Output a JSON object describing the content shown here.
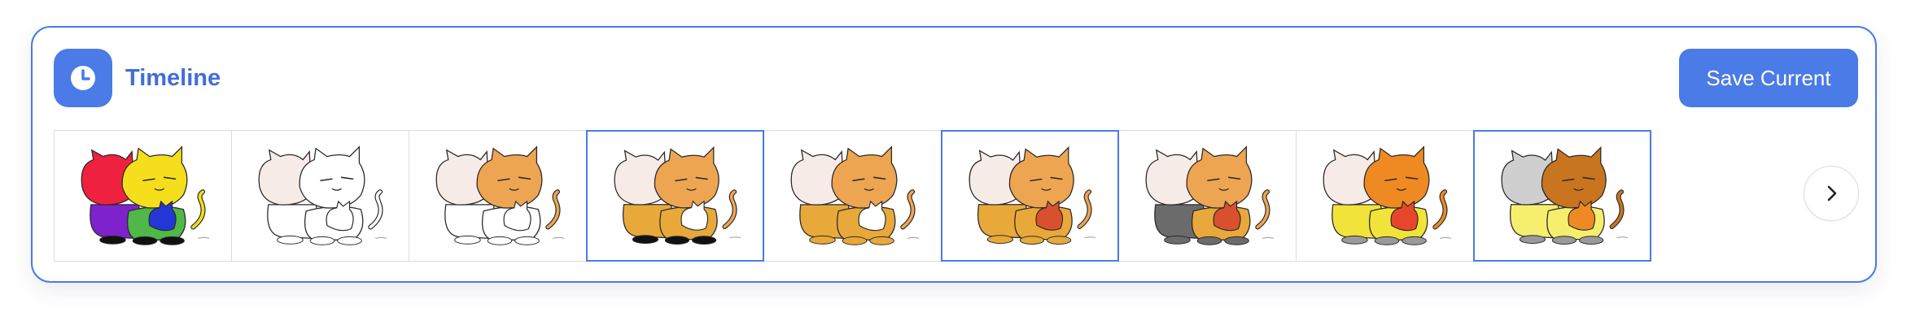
{
  "timeline": {
    "title": "Timeline",
    "icon": "clock-icon",
    "save_label": "Save Current",
    "next_icon": "chevron-right-icon",
    "accent_color": "#4a7be6",
    "frames": [
      {
        "label": "colored-complete",
        "selected": false,
        "back": "#f0213e",
        "front": "#f5de1b",
        "body_back": "#7e22ce",
        "body_front": "#4fb848",
        "small": "#2437d6",
        "shoes": "#111111"
      },
      {
        "label": "line-art",
        "selected": false,
        "back": "#f7ebe8",
        "front": "#ffffff",
        "body_back": "#ffffff",
        "body_front": "#ffffff",
        "small": "#ffffff",
        "shoes": "#ffffff"
      },
      {
        "label": "orange-head",
        "selected": false,
        "back": "#f7ebe8",
        "front": "#eea552",
        "body_back": "#ffffff",
        "body_front": "#ffffff",
        "small": "#ffffff",
        "shoes": "#ffffff"
      },
      {
        "label": "orange-body",
        "selected": true,
        "back": "#f7ebe8",
        "front": "#eea552",
        "body_back": "#e8a93a",
        "body_front": "#e8a93a",
        "small": "#ffffff",
        "shoes": "#111111"
      },
      {
        "label": "orange-body-boots",
        "selected": false,
        "back": "#f7ebe8",
        "front": "#eea552",
        "body_back": "#e8a93a",
        "body_front": "#e8a93a",
        "small": "#ffffff",
        "shoes": "#e8a93a"
      },
      {
        "label": "red-small-cat",
        "selected": true,
        "back": "#f7ebe8",
        "front": "#eea552",
        "body_back": "#e8a93a",
        "body_front": "#e8a93a",
        "small": "#d9502f",
        "shoes": "#e8a93a"
      },
      {
        "label": "gray-shadow",
        "selected": false,
        "back": "#f7ebe8",
        "front": "#eea552",
        "body_back": "#6b6b6b",
        "body_front": "#e8a93a",
        "small": "#d9502f",
        "shoes": "#6b6b6b"
      },
      {
        "label": "yellow-body",
        "selected": false,
        "back": "#f7ebe8",
        "front": "#ef8a22",
        "body_back": "#f2e33a",
        "body_front": "#f2e33a",
        "small": "#e8462a",
        "shoes": "#9a9a9a"
      },
      {
        "label": "gray-back-cat",
        "selected": true,
        "back": "#cfcfcf",
        "front": "#c9741e",
        "body_back": "#f6ef6e",
        "body_front": "#f6ef6e",
        "small": "#ef8a22",
        "shoes": "#9a9a9a"
      }
    ]
  }
}
